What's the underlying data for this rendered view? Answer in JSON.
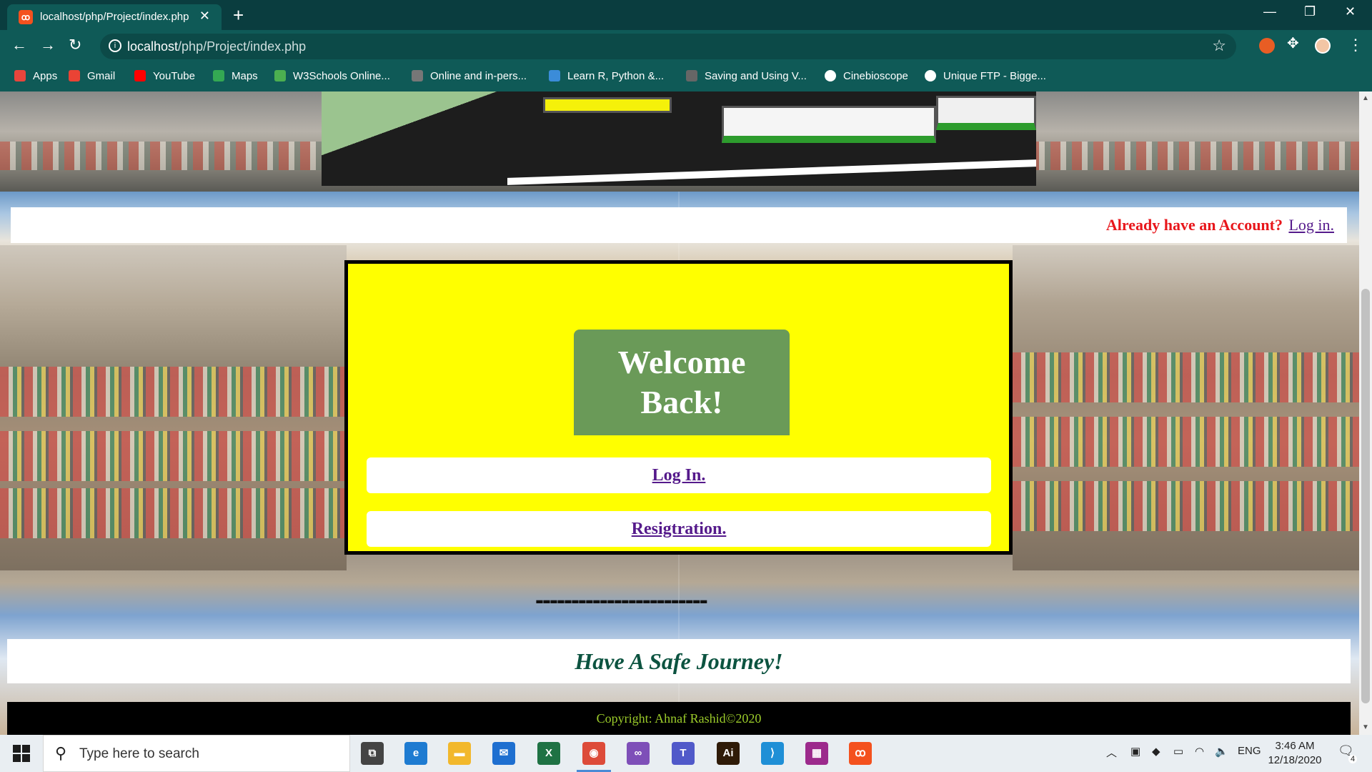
{
  "browser": {
    "tab_title": "localhost/php/Project/index.php",
    "tab_close": "✕",
    "new_tab": "+",
    "url_host": "localhost",
    "url_path": "/php/Project/index.php",
    "window_controls": [
      "—",
      "❐",
      "✕"
    ],
    "bookmarks": [
      {
        "label": "Apps",
        "icon": "apps-grid-icon",
        "color": "#e8453c"
      },
      {
        "label": "Gmail",
        "icon": "gmail-icon",
        "color": "#ea4335"
      },
      {
        "label": "YouTube",
        "icon": "youtube-icon",
        "color": "#ff0000"
      },
      {
        "label": "Maps",
        "icon": "maps-icon",
        "color": "#34a853"
      },
      {
        "label": "W3Schools Online...",
        "icon": "w3schools-icon",
        "color": "#4caf50"
      },
      {
        "label": "Online and in-pers...",
        "icon": "globe-icon",
        "color": "#777777"
      },
      {
        "label": "Learn R, Python &...",
        "icon": "shield-icon",
        "color": "#3b8cd9"
      },
      {
        "label": "Saving and Using V...",
        "icon": "feather-icon",
        "color": "#666666"
      },
      {
        "label": "Cinebioscope",
        "icon": "globe-icon",
        "color": "#ffffff"
      },
      {
        "label": "Unique FTP - Bigge...",
        "icon": "globe-icon",
        "color": "#ffffff"
      }
    ]
  },
  "page": {
    "account_prompt": "Already have an Account?",
    "account_link": "Log in.",
    "welcome_line1": "Welcome",
    "welcome_line2": "Back!",
    "login_button": "Log In.",
    "registration_button": "Resigtration.",
    "dashes": "------------------------",
    "tagline": "Have A Safe Journey!",
    "copyright": "Copyright: Ahnaf Rashid©2020"
  },
  "colors": {
    "card_bg": "#ffff00",
    "welcome_bg": "#6a9a58",
    "prompt_red": "#e8161b",
    "link_purple": "#551a8b",
    "tagline_green": "#0c5340",
    "footer_text": "#9ccc2a"
  },
  "taskbar": {
    "search_placeholder": "Type here to search",
    "language": "ENG",
    "time": "3:46 AM",
    "date": "12/18/2020",
    "notification_count": "4",
    "apps": [
      {
        "name": "task-view",
        "color": "#444444",
        "label": "⧉"
      },
      {
        "name": "edge",
        "color": "#1e7bd1",
        "label": "e"
      },
      {
        "name": "file-explorer",
        "color": "#f2b82c",
        "label": "▬"
      },
      {
        "name": "mail",
        "color": "#1e6fd0",
        "label": "✉"
      },
      {
        "name": "excel",
        "color": "#1f7244",
        "label": "X"
      },
      {
        "name": "chrome",
        "color": "#dd4b39",
        "label": "◉"
      },
      {
        "name": "visual-studio",
        "color": "#7e4fb8",
        "label": "∞"
      },
      {
        "name": "teams",
        "color": "#5059c9",
        "label": "T"
      },
      {
        "name": "illustrator",
        "color": "#2f1b08",
        "label": "Ai"
      },
      {
        "name": "vscode",
        "color": "#1f8fd6",
        "label": "⟩"
      },
      {
        "name": "winrar",
        "color": "#9c2a8c",
        "label": "▦"
      },
      {
        "name": "xampp",
        "color": "#f4511e",
        "label": "ꝏ"
      }
    ]
  }
}
